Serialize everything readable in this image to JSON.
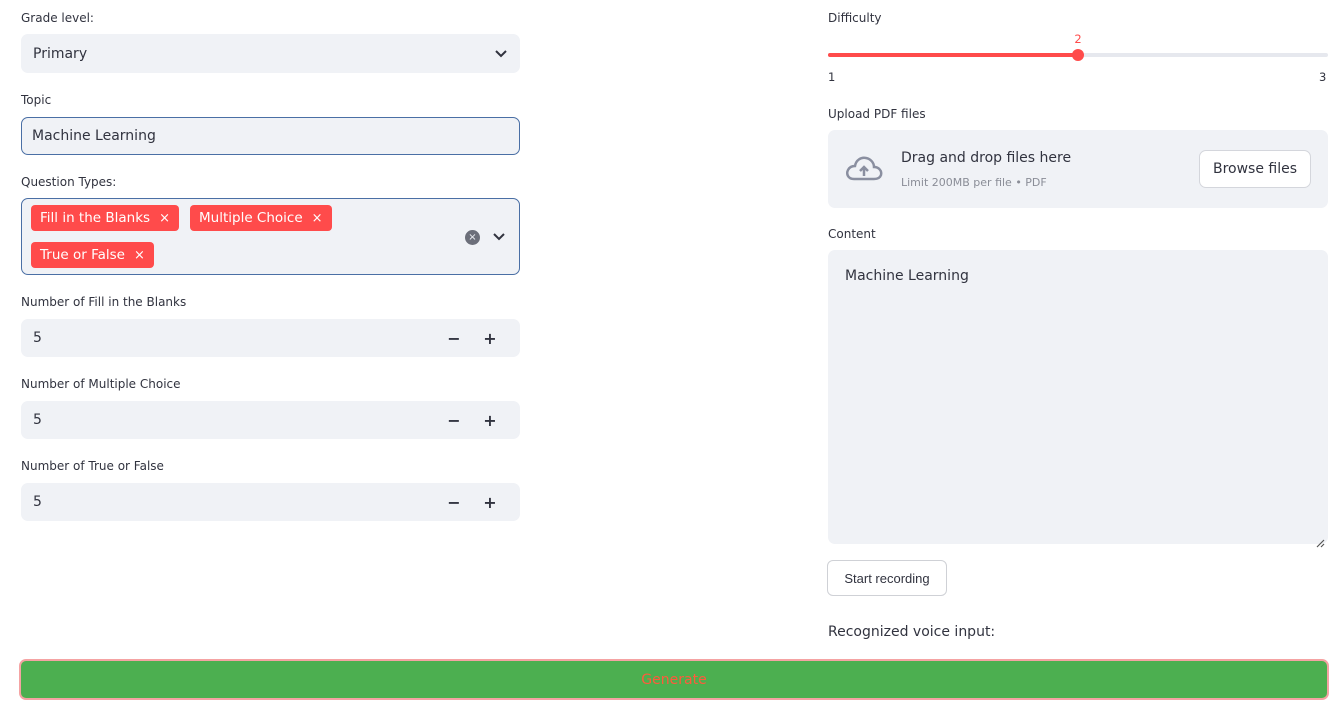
{
  "grade_level": {
    "label": "Grade level:",
    "selected": "Primary"
  },
  "topic": {
    "label": "Topic",
    "value": "Machine Learning"
  },
  "question_types": {
    "label": "Question Types:",
    "selected": [
      "Fill in the Blanks",
      "Multiple Choice",
      "True or False"
    ],
    "remove_glyph": "×",
    "clear_glyph": "×"
  },
  "counts": [
    {
      "label": "Number of Fill in the Blanks",
      "value": "5"
    },
    {
      "label": "Number of Multiple Choice",
      "value": "5"
    },
    {
      "label": "Number of True or False",
      "value": "5"
    }
  ],
  "stepper": {
    "minus": "−",
    "plus": "+"
  },
  "difficulty": {
    "label": "Difficulty",
    "min": 1,
    "max": 3,
    "value": 2,
    "min_label": "1",
    "max_label": "3",
    "value_label": "2"
  },
  "upload": {
    "label": "Upload PDF files",
    "title": "Drag and drop files here",
    "subtitle": "Limit 200MB per file • PDF",
    "browse_label": "Browse files"
  },
  "content": {
    "label": "Content",
    "value": "Machine Learning"
  },
  "recording": {
    "button_label": "Start recording",
    "recognized_label": "Recognized voice input:"
  },
  "generate": {
    "label": "Generate"
  },
  "colors": {
    "accent": "#ff4b4b",
    "input_bg": "#f0f2f6",
    "focus_border": "#4a6fa5",
    "generate_bg": "#4caf50"
  }
}
